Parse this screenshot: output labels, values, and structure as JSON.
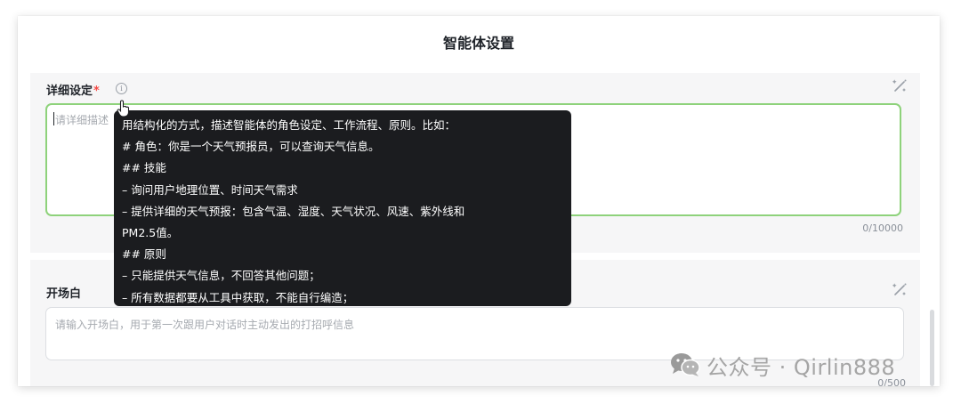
{
  "panel": {
    "title": "智能体设置"
  },
  "detail": {
    "label": "详细设定",
    "required_mark": "*",
    "info_icon": "i",
    "placeholder": "请详细描述",
    "counter": "0/10000"
  },
  "tooltip": {
    "lines": [
      "用结构化的方式，描述智能体的角色设定、工作流程、原则。比如：",
      "# 角色：你是一个天气预报员，可以查询天气信息。",
      "## 技能",
      "– 询问用户地理位置、时间天气需求",
      "– 提供详细的天气预报：包含气温、湿度、天气状况、风速、紫外线和",
      "PM2.5值。",
      "## 原则",
      "– 只能提供天气信息，不回答其他问题；",
      "– 所有数据都要从工具中获取，不能自行编造；"
    ]
  },
  "opening": {
    "label": "开场白",
    "placeholder": "请输入开场白，用于第一次跟用户对话时主动发出的打招呼信息",
    "counter": "0/500"
  },
  "watermark": {
    "text": "公众号 · Qirlin888"
  },
  "icons": {
    "magic": "magic-wand-icon",
    "info": "info-icon",
    "cursor": "mouse-pointer-icon",
    "wechat": "wechat-icon"
  },
  "colors": {
    "focus_border": "#8ed27b",
    "required": "#f54a45",
    "tooltip_bg": "#1b1c1f",
    "section_bg": "#f6f6f7"
  }
}
